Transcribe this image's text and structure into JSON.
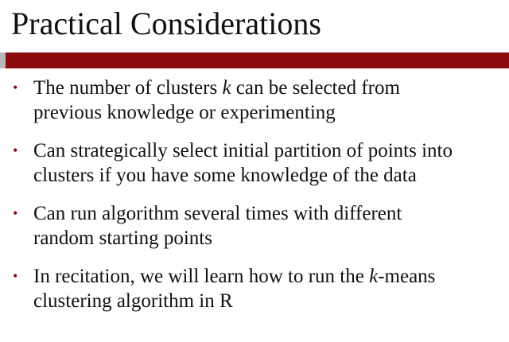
{
  "slide": {
    "title": "Practical Considerations",
    "bullet_marker": "•",
    "bullets": [
      {
        "line1_a": "The number of clusters ",
        "line1_em": "k",
        "line1_b": " can be selected from",
        "line2": "previous knowledge or experimenting"
      },
      {
        "line1": "Can strategically select initial partition of points into",
        "line2": "clusters if you have some knowledge of the data"
      },
      {
        "line1": "Can run algorithm several times with different",
        "line2": "random starting points"
      },
      {
        "line1_a": "In recitation, we will learn how to run the ",
        "line1_em": "k",
        "line1_b": "-means",
        "line2": "clustering algorithm in R"
      }
    ]
  },
  "colors": {
    "accent": "#8c0b0f",
    "divider_grey": "#b8b8b8",
    "text": "#111111",
    "background": "#ffffff"
  }
}
